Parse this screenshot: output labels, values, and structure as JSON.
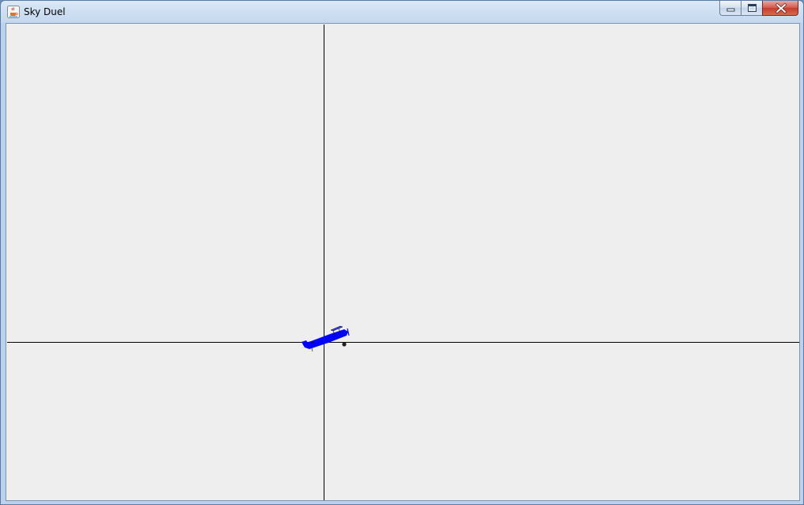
{
  "window": {
    "title": "Sky Duel",
    "app_icon": "java-coffee-cup-icon",
    "controls": {
      "minimize_icon": "minimize-icon",
      "maximize_icon": "maximize-icon",
      "close_icon": "close-icon"
    }
  },
  "game": {
    "background_color": "#eeeeee",
    "axis_color": "#000000",
    "player_plane": {
      "color": "#0000ff",
      "icon": "biplane-icon"
    },
    "projectile": {
      "color": "#222222",
      "icon": "cannonball-icon"
    }
  }
}
